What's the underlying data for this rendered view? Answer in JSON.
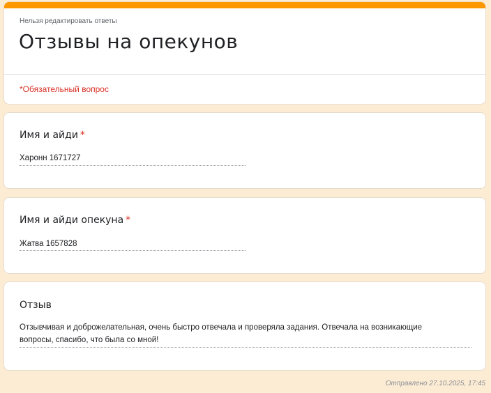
{
  "header": {
    "no_edit_note": "Нельзя редактировать ответы",
    "title": "Отзывы на опекунов",
    "required_note": "*Обязательный вопрос",
    "accent_color": "#ff9800"
  },
  "questions": [
    {
      "title": "Имя и айди",
      "required_mark": "*",
      "answer": "Харонн  1671727"
    },
    {
      "title": "Имя и айди опекуна",
      "required_mark": "*",
      "answer": "Жатва 1657828"
    },
    {
      "title": "Отзыв",
      "answer": "Отзывчивая и доброжелательная, очень быстро отвечала и проверяла задания. Отвечала на возникающие вопросы, спасибо, что была со мной!"
    }
  ],
  "footer": {
    "sent": "Отправлено 27.10.2025, 17:45"
  },
  "colors": {
    "page_background": "#fdecd4",
    "required_red": "#d93025"
  }
}
